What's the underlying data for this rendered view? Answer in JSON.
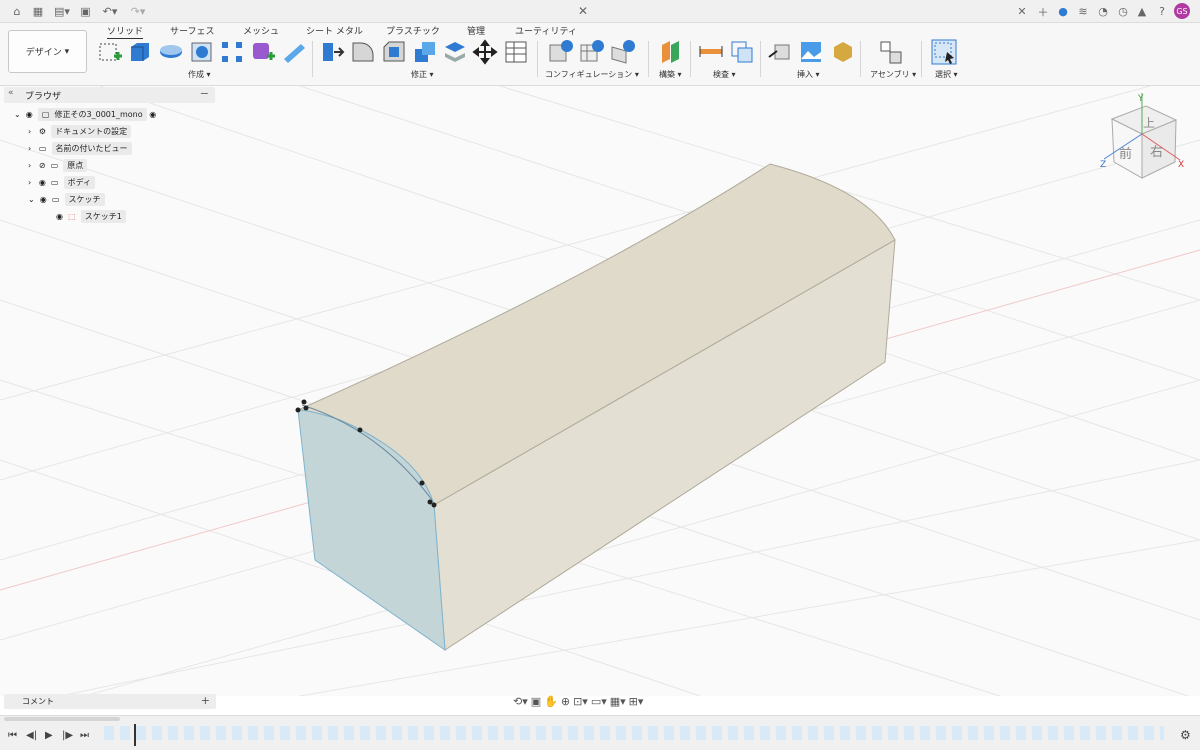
{
  "tabs": [
    "ソリッド",
    "サーフェス",
    "メッシュ",
    "シート メタル",
    "プラスチック",
    "管理",
    "ユーティリティ"
  ],
  "workspace": "デザイン",
  "groups": {
    "create": "作成",
    "modify": "修正",
    "config": "コンフィギュレーション",
    "construct": "構築",
    "inspect": "検査",
    "insert": "挿入",
    "assemble": "アセンブリ",
    "select": "選択"
  },
  "browser": {
    "title": "ブラウザ",
    "document": "修正その3_0001_mono",
    "items": [
      "ドキュメントの設定",
      "名前の付いたビュー",
      "原点",
      "ボディ",
      "スケッチ"
    ],
    "sketch_child": "スケッチ1"
  },
  "comment": "コメント",
  "user_initials": "GS",
  "viewcube": {
    "top": "上",
    "front": "前",
    "right": "右",
    "x": "X",
    "y": "Y",
    "z": "Z"
  },
  "icons": [
    "home-icon",
    "grid-icon",
    "file-icon",
    "save-icon",
    "undo-icon",
    "redo-icon",
    "close-icon",
    "add-icon",
    "notification-icon",
    "help-icon",
    "settings-icon"
  ],
  "colors": {
    "body": "#e0dacb",
    "face_selected": "#c3d5d6",
    "accent": "#2f7bd1"
  }
}
